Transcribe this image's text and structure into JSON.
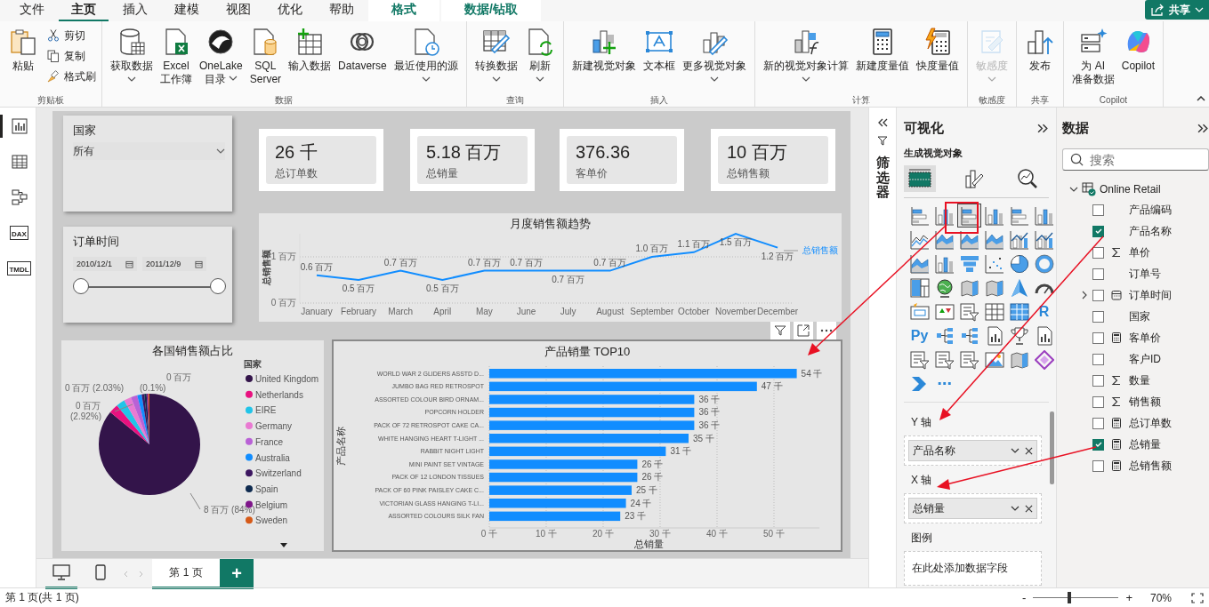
{
  "menu_tabs": [
    {
      "label": "文件",
      "kind": "normal",
      "selected": false
    },
    {
      "label": "主页",
      "kind": "normal",
      "selected": true
    },
    {
      "label": "插入",
      "kind": "normal",
      "selected": false
    },
    {
      "label": "建模",
      "kind": "normal",
      "selected": false
    },
    {
      "label": "视图",
      "kind": "normal",
      "selected": false
    },
    {
      "label": "优化",
      "kind": "normal",
      "selected": false
    },
    {
      "label": "帮助",
      "kind": "normal",
      "selected": false
    },
    {
      "label": "格式",
      "kind": "contextual",
      "selected": false
    },
    {
      "label": "数据/钻取",
      "kind": "contextual",
      "selected": false
    }
  ],
  "share_button": {
    "label": "共享"
  },
  "ribbon_groups": [
    {
      "label": "剪贴板",
      "buttons": [
        {
          "kind": "paste",
          "lines": [
            "粘贴"
          ],
          "dropdown": false,
          "disabled": false
        }
      ],
      "small_buttons": [
        {
          "kind": "cut",
          "label": "剪切"
        },
        {
          "kind": "copy",
          "label": "复制"
        },
        {
          "kind": "painter",
          "label": "格式刷"
        }
      ]
    },
    {
      "label": "数据",
      "buttons": [
        {
          "kind": "database",
          "lines": [
            "获取数据"
          ],
          "dropdown": true,
          "disabled": false
        },
        {
          "kind": "excel",
          "lines": [
            "Excel",
            "工作簿"
          ],
          "dropdown": false,
          "disabled": false
        },
        {
          "kind": "onelake",
          "lines": [
            "OneLake",
            "目录"
          ],
          "dropdown": true,
          "disabled": false
        },
        {
          "kind": "sql",
          "lines": [
            "SQL",
            "Server"
          ],
          "dropdown": false,
          "disabled": false
        },
        {
          "kind": "enter",
          "lines": [
            "输入数据"
          ],
          "dropdown": false,
          "disabled": false
        },
        {
          "kind": "dataverse",
          "lines": [
            "Dataverse"
          ],
          "dropdown": false,
          "disabled": false
        },
        {
          "kind": "recent",
          "lines": [
            "最近使用的源"
          ],
          "dropdown": true,
          "disabled": false
        }
      ]
    },
    {
      "label": "查询",
      "buttons": [
        {
          "kind": "transform",
          "lines": [
            "转换数据"
          ],
          "dropdown": true,
          "disabled": false
        },
        {
          "kind": "refresh",
          "lines": [
            "刷新"
          ],
          "dropdown": true,
          "disabled": false
        }
      ]
    },
    {
      "label": "插入",
      "buttons": [
        {
          "kind": "newvisual",
          "lines": [
            "新建视觉对象"
          ],
          "dropdown": false,
          "disabled": false
        },
        {
          "kind": "textbox",
          "lines": [
            "文本框"
          ],
          "dropdown": false,
          "disabled": false
        },
        {
          "kind": "morevisuals",
          "lines": [
            "更多视觉对象"
          ],
          "dropdown": true,
          "disabled": false
        }
      ]
    },
    {
      "label": "计算",
      "buttons": [
        {
          "kind": "visualcalc",
          "lines": [
            "新的视觉对象计算"
          ],
          "dropdown": true,
          "disabled": false
        },
        {
          "kind": "calculator",
          "lines": [
            "新建度量值"
          ],
          "dropdown": false,
          "disabled": false
        },
        {
          "kind": "quickmeasure",
          "lines": [
            "快度量值"
          ],
          "dropdown": false,
          "disabled": false
        }
      ]
    },
    {
      "label": "敏感度",
      "buttons": [
        {
          "kind": "sensitivity",
          "lines": [
            "敏感度"
          ],
          "dropdown": true,
          "disabled": true
        }
      ]
    },
    {
      "label": "共享",
      "buttons": [
        {
          "kind": "publish",
          "lines": [
            "发布"
          ],
          "dropdown": false,
          "disabled": false
        }
      ]
    },
    {
      "label": "Copilot",
      "buttons": [
        {
          "kind": "aidata",
          "lines": [
            "为 AI",
            "准备数据"
          ],
          "dropdown": false,
          "disabled": false
        },
        {
          "kind": "copilot",
          "lines": [
            "Copilot"
          ],
          "dropdown": false,
          "disabled": false
        }
      ]
    }
  ],
  "view_rail": [
    {
      "kind": "report",
      "selected": true
    },
    {
      "kind": "table",
      "selected": false
    },
    {
      "kind": "model",
      "selected": false
    },
    {
      "kind": "dax",
      "label": "DAX",
      "selected": false
    },
    {
      "kind": "tmdl",
      "label": "TMDL",
      "selected": false
    }
  ],
  "report": {
    "country_slicer": {
      "title": "国家",
      "value": "所有"
    },
    "date_slicer": {
      "title": "订单时间",
      "from": {
        "value": "2010/12/1",
        "level": 0
      },
      "to": {
        "value": "2011/12/9",
        "level": 1
      }
    },
    "cards": [
      {
        "value": "26 千",
        "label": "总订单数"
      },
      {
        "value": "5.18 百万",
        "label": "总销量"
      },
      {
        "value": "376.36",
        "label": "客单价"
      },
      {
        "value": "10 百万",
        "label": "总销售额"
      }
    ],
    "line_chart": {
      "selected": false,
      "chart_data": {
        "type": "line",
        "title": "月度销售额趋势",
        "ylabel": "总销售额",
        "categories": [
          "January",
          "February",
          "March",
          "April",
          "May",
          "June",
          "July",
          "August",
          "September",
          "October",
          "November",
          "December"
        ],
        "series": [
          {
            "name": "总销售额",
            "color": "#118dff",
            "values": [
              0.6,
              0.5,
              0.7,
              0.5,
              0.7,
              0.7,
              0.7,
              0.7,
              1.0,
              1.1,
              1.5,
              1.2
            ]
          }
        ],
        "value_labels": [
          "0.6 百万",
          "0.5 百万",
          "0.7 百万",
          "0.5 百万",
          "0.7 百万",
          "0.7 百万",
          "0.7 百万",
          "0.7 百万",
          "1.0 百万",
          "1.1 百万",
          "1.5 百万",
          "1.2 百万"
        ],
        "ylim": [
          0,
          1.5
        ],
        "grid": true,
        "yticks": [
          {
            "value": 0,
            "label": "0 百万"
          },
          {
            "value": 1,
            "label": "1 百万"
          }
        ]
      }
    },
    "pie_chart": {
      "title": "各国销售额占比",
      "legend_title": "国家",
      "legend": [
        {
          "name": "United Kingdom",
          "color": "#33144a"
        },
        {
          "name": "Netherlands",
          "color": "#e8117f"
        },
        {
          "name": "EIRE",
          "color": "#21c4e8"
        },
        {
          "name": "Germany",
          "color": "#e97ad2"
        },
        {
          "name": "France",
          "color": "#b961d6"
        },
        {
          "name": "Australia",
          "color": "#118dff"
        },
        {
          "name": "Switzerland",
          "color": "#3c1660"
        },
        {
          "name": "Spain",
          "color": "#0e2a4f"
        },
        {
          "name": "Belgium",
          "color": "#7e1589"
        },
        {
          "name": "Sweden",
          "color": "#d65a18"
        }
      ],
      "data_labels": [
        "0 百万",
        "0 百万 (2.03%)",
        "(0.1%)",
        "0 百万",
        "(2.92%)",
        "8 百万 (84%)"
      ]
    },
    "bar_chart": {
      "selected": true,
      "chart_data": {
        "type": "bar",
        "orientation": "horizontal",
        "title": "产品销量 TOP10",
        "xlabel": "总销量",
        "ylabel": "产品名称",
        "categories": [
          "WORLD WAR 2 GLIDERS ASSTD D...",
          "JUMBO BAG RED RETROSPOT",
          "ASSORTED COLOUR BIRD ORNAM...",
          "POPCORN HOLDER",
          "PACK OF 72 RETROSPOT CAKE CA...",
          "WHITE HANGING HEART T-LIGHT ...",
          "RABBIT NIGHT LIGHT",
          "MINI PAINT SET VINTAGE",
          "PACK OF 12 LONDON TISSUES",
          "PACK OF 60 PINK PAISLEY CAKE C...",
          "VICTORIAN GLASS HANGING T-LI...",
          "ASSORTED COLOURS SILK FAN"
        ],
        "series": [
          {
            "color": "#118dff",
            "values": [
              54,
              47,
              36,
              36,
              36,
              35,
              31,
              26,
              26,
              25,
              24,
              23
            ]
          }
        ],
        "value_labels": [
          "54 千",
          "47 千",
          "36 千",
          "36 千",
          "36 千",
          "35 千",
          "31 千",
          "26 千",
          "26 千",
          "25 千",
          "24 千",
          "23 千"
        ],
        "xlim": [
          0,
          58
        ],
        "grid": true,
        "xticks": [
          {
            "value": 0,
            "label": "0 千"
          },
          {
            "value": 10,
            "label": "10 千"
          },
          {
            "value": 20,
            "label": "20 千"
          },
          {
            "value": 30,
            "label": "30 千"
          },
          {
            "value": 40,
            "label": "40 千"
          },
          {
            "value": 50,
            "label": "50 千"
          }
        ]
      }
    }
  },
  "page_bar": {
    "views": [
      {
        "kind": "desktop",
        "selected": true
      },
      {
        "kind": "phone",
        "selected": false
      }
    ],
    "pages": [
      {
        "label": "第 1 页",
        "selected": true
      }
    ],
    "add_label": "+"
  },
  "filters_pane": {
    "title": "筛选器"
  },
  "visualizations": {
    "title": "可视化",
    "subtitle": "生成视觉对象",
    "modes": [
      {
        "kind": "build",
        "selected": true
      },
      {
        "kind": "format",
        "selected": false
      },
      {
        "kind": "analytics",
        "selected": false
      }
    ],
    "types": [
      {
        "kind": "hbar",
        "selected": false
      },
      {
        "kind": "vbar",
        "selected": false
      },
      {
        "kind": "hbar",
        "selected": true
      },
      {
        "kind": "vbar",
        "selected": false
      },
      {
        "kind": "hbar",
        "selected": false
      },
      {
        "kind": "vbar",
        "selected": false
      },
      {
        "kind": "line",
        "selected": false
      },
      {
        "kind": "area",
        "selected": false
      },
      {
        "kind": "area",
        "selected": false
      },
      {
        "kind": "area",
        "selected": false
      },
      {
        "kind": "combo",
        "selected": false
      },
      {
        "kind": "combo",
        "selected": false
      },
      {
        "kind": "area",
        "selected": false
      },
      {
        "kind": "vbar",
        "selected": false
      },
      {
        "kind": "funnel",
        "selected": false
      },
      {
        "kind": "scatter",
        "selected": false
      },
      {
        "kind": "pie",
        "selected": false
      },
      {
        "kind": "donut",
        "selected": false
      },
      {
        "kind": "treemap",
        "selected": false
      },
      {
        "kind": "globe",
        "selected": false
      },
      {
        "kind": "map",
        "selected": false
      },
      {
        "kind": "map",
        "selected": false
      },
      {
        "kind": "arrow",
        "selected": false
      },
      {
        "kind": "gauge",
        "selected": false
      },
      {
        "kind": "card",
        "selected": false
      },
      {
        "kind": "kpi",
        "selected": false
      },
      {
        "kind": "slicer",
        "selected": false
      },
      {
        "kind": "table",
        "selected": false
      },
      {
        "kind": "matrix",
        "selected": false
      },
      {
        "kind": "text",
        "label": "R",
        "selected": false
      },
      {
        "kind": "text",
        "label": "Py",
        "selected": false
      },
      {
        "kind": "tree",
        "selected": false
      },
      {
        "kind": "tree",
        "selected": false
      },
      {
        "kind": "doc",
        "selected": false
      },
      {
        "kind": "trophy",
        "selected": false
      },
      {
        "kind": "doc",
        "selected": false
      },
      {
        "kind": "slicer",
        "selected": false
      },
      {
        "kind": "slicer",
        "selected": false
      },
      {
        "kind": "slicer",
        "selected": false
      },
      {
        "kind": "image",
        "selected": false
      },
      {
        "kind": "map",
        "selected": false
      },
      {
        "kind": "diamond",
        "selected": false
      },
      {
        "kind": "chevron",
        "selected": false
      },
      {
        "kind": "text",
        "label": "⋯",
        "selected": false
      }
    ],
    "wells": [
      {
        "label": "Y 轴",
        "field": "产品名称"
      },
      {
        "label": "X 轴",
        "field": "总销量"
      },
      {
        "label": "图例",
        "placeholder": "在此处添加数据字段"
      }
    ]
  },
  "data_pane": {
    "title": "数据",
    "search_placeholder": "搜索",
    "tables": [
      {
        "name": "Online Retail",
        "expanded": true,
        "fields": [
          {
            "name": "产品编码",
            "kind": "text",
            "checked": false
          },
          {
            "name": "产品名称",
            "kind": "text",
            "checked": true
          },
          {
            "name": "单价",
            "kind": "sum",
            "checked": false
          },
          {
            "name": "订单号",
            "kind": "text",
            "checked": false
          },
          {
            "name": "订单时间",
            "kind": "date",
            "checked": false
          },
          {
            "name": "国家",
            "kind": "text",
            "checked": false
          },
          {
            "name": "客单价",
            "kind": "measure",
            "checked": false
          },
          {
            "name": "客户ID",
            "kind": "text",
            "checked": false
          },
          {
            "name": "数量",
            "kind": "sum",
            "checked": false
          },
          {
            "name": "销售额",
            "kind": "sum",
            "checked": false
          },
          {
            "name": "总订单数",
            "kind": "measure",
            "checked": false
          },
          {
            "name": "总销量",
            "kind": "measure",
            "checked": true
          },
          {
            "name": "总销售额",
            "kind": "measure",
            "checked": false
          }
        ]
      }
    ]
  },
  "status_bar": {
    "page_info": "第 1 页(共 1 页)",
    "zoom": {
      "minus": "-",
      "plus": "+",
      "level": 0.42,
      "reading": "70%"
    }
  }
}
